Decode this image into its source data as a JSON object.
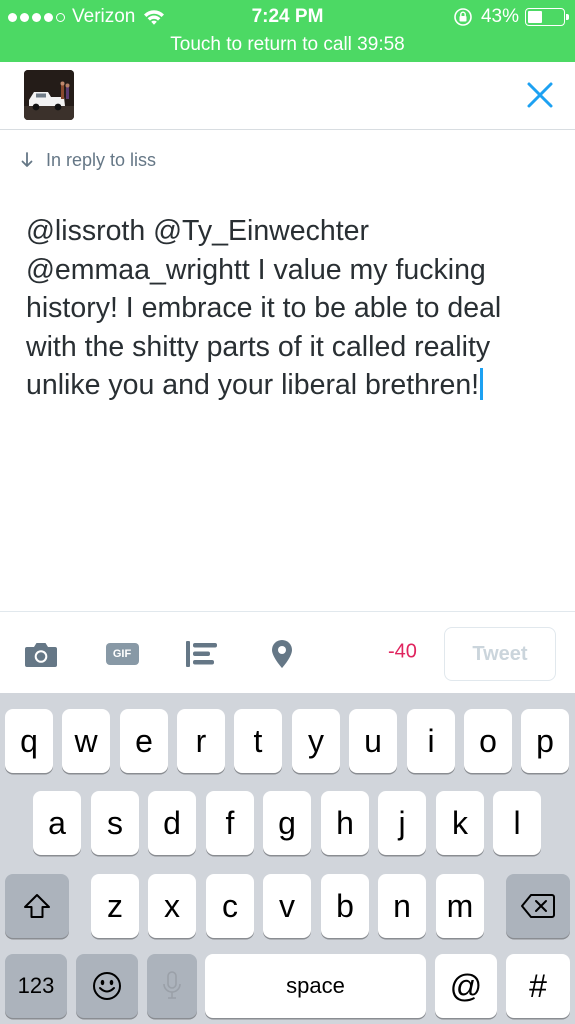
{
  "status_bar": {
    "carrier": "Verizon",
    "time": "7:24 PM",
    "battery": "43%",
    "battery_level": 0.43,
    "call_banner": "Touch to return to call 39:58"
  },
  "compose": {
    "reply_to": "In reply to liss",
    "text": "@lissroth @Ty_Einwechter\n@emmaa_wrightt I value my fucking history! I embrace it to be able to deal with the shitty parts of it called reality unlike you and your liberal brethren!",
    "char_count": "-40",
    "tweet_label": "Tweet"
  },
  "toolbar": {
    "icons": [
      "camera-icon",
      "gif-icon",
      "poll-icon",
      "location-pin-icon"
    ],
    "gif_label": "GIF"
  },
  "keyboard": {
    "row1": [
      "q",
      "w",
      "e",
      "r",
      "t",
      "y",
      "u",
      "i",
      "o",
      "p"
    ],
    "row2": [
      "a",
      "s",
      "d",
      "f",
      "g",
      "h",
      "j",
      "k",
      "l"
    ],
    "row3": [
      "z",
      "x",
      "c",
      "v",
      "b",
      "n",
      "m"
    ],
    "numbers_label": "123",
    "space_label": "space",
    "at_label": "@",
    "hash_label": "#"
  },
  "colors": {
    "call_green": "#4cd964",
    "twitter_blue": "#1da1f2",
    "over_limit_red": "#e0245e"
  }
}
